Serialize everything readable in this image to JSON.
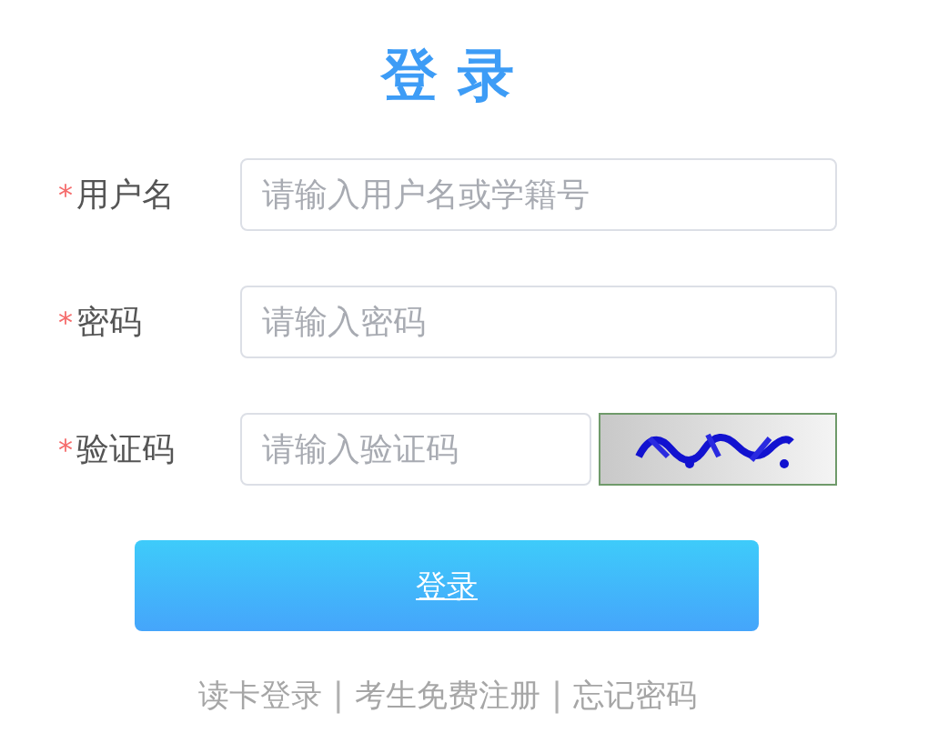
{
  "title": "登 录",
  "fields": [
    {
      "kind": "text",
      "required_mark": "*",
      "label": "用户名",
      "placeholder": "请输入用户名或学籍号"
    },
    {
      "kind": "password",
      "required_mark": "*",
      "label": "密码",
      "placeholder": "请输入密码"
    },
    {
      "kind": "captcha",
      "required_mark": "*",
      "label": "验证码",
      "placeholder": "请输入验证码"
    }
  ],
  "submit": "登录",
  "footer": [
    {
      "kind": "link",
      "text": "读卡登录"
    },
    {
      "kind": "separator",
      "text": "|"
    },
    {
      "kind": "link",
      "text": "考生免费注册"
    },
    {
      "kind": "separator",
      "text": "|"
    },
    {
      "kind": "link",
      "text": "忘记密码"
    }
  ]
}
